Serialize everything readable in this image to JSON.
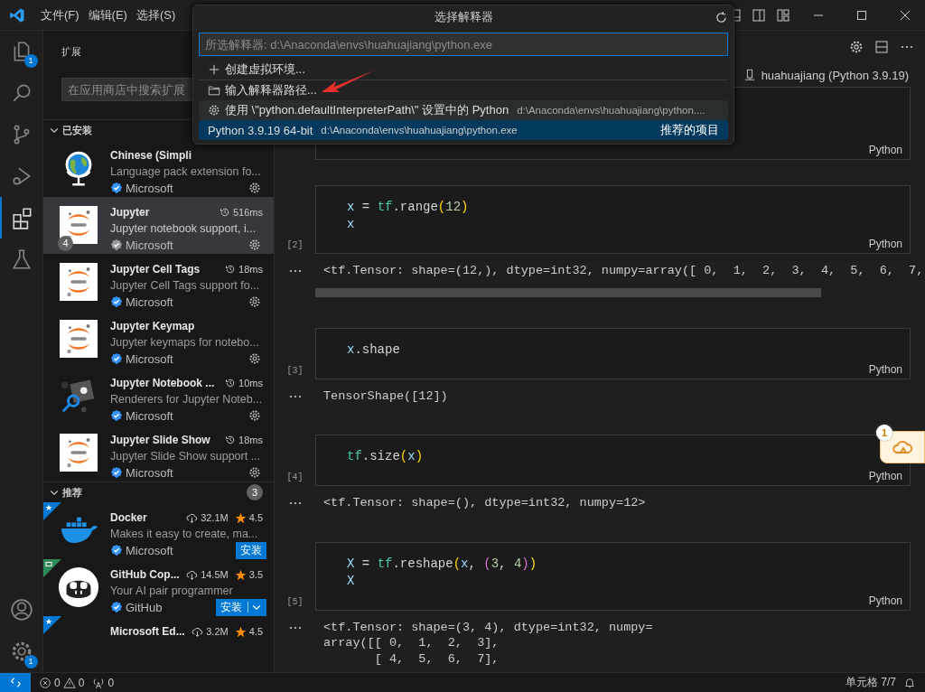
{
  "title_bar": {
    "menus": [
      "文件(F)",
      "编辑(E)",
      "选择(S)"
    ]
  },
  "activity_bar": {
    "items": [
      {
        "kind": "files",
        "selected": false,
        "badge": "1"
      },
      {
        "kind": "search",
        "selected": false
      },
      {
        "kind": "source-control",
        "selected": false
      },
      {
        "kind": "run",
        "selected": false
      },
      {
        "kind": "extensions",
        "selected": true
      },
      {
        "kind": "testing",
        "selected": false
      }
    ],
    "bottom": [
      {
        "kind": "account"
      },
      {
        "kind": "manage",
        "badge": "1"
      }
    ]
  },
  "sidebar": {
    "title": "扩展",
    "search": {
      "placeholder": "在应用商店中搜索扩展"
    },
    "sections": [
      {
        "title": "已安装",
        "expanded": true,
        "items": [
          {
            "kind": "globe",
            "name": "Chinese (Simpli",
            "description": "Language pack extension fo...",
            "publisher": "Microsoft",
            "selected": false
          },
          {
            "kind": "jupyter",
            "name": "Jupyter",
            "time": "516ms",
            "description": "Jupyter notebook support, i...",
            "publisher": "Microsoft",
            "badge": "4",
            "selected": true
          },
          {
            "kind": "jupyter",
            "name": "Jupyter Cell Tags",
            "time": "18ms",
            "description": "Jupyter Cell Tags support fo...",
            "publisher": "Microsoft",
            "selected": false
          },
          {
            "kind": "jupyter",
            "name": "Jupyter Keymap",
            "description": "Jupyter keymaps for notebo...",
            "publisher": "Microsoft",
            "selected": false
          },
          {
            "kind": "renderers",
            "name": "Jupyter Notebook ...",
            "time": "10ms",
            "description": "Renderers for Jupyter Noteb...",
            "publisher": "Microsoft",
            "selected": false
          },
          {
            "kind": "jupyter",
            "name": "Jupyter Slide Show",
            "time": "18ms",
            "description": "Jupyter Slide Show support ...",
            "publisher": "Microsoft",
            "selected": false
          }
        ]
      },
      {
        "title": "推荐",
        "expanded": true,
        "count": "3",
        "items": [
          {
            "kind": "docker",
            "ribbon": {
              "kind": "star"
            },
            "name": "Docker",
            "downloads": "32.1M",
            "rating": "4.5",
            "description": "Makes it easy to create, ma...",
            "publisher": "Microsoft",
            "install": "安装",
            "split": false,
            "selected": false
          },
          {
            "kind": "copilot",
            "ribbon": {
              "kind": "preview"
            },
            "name": "GitHub Cop...",
            "downloads": "14.5M",
            "rating": "3.5",
            "description": "Your AI pair programmer",
            "publisher": "GitHub",
            "install": "安装",
            "split": true,
            "selected": false
          },
          {
            "kind": "hidden",
            "ribbon": {
              "kind": "star"
            },
            "name": "Microsoft Ed...",
            "downloads": "3.2M",
            "rating": "4.5",
            "selected": false
          }
        ]
      }
    ]
  },
  "editor": {
    "kernel": "huahuajiang (Python 3.9.19)",
    "cells": [
      {
        "language": "Python"
      },
      {
        "count": "[2]",
        "language": "Python",
        "code": [
          [
            {
              "kind": "var",
              "t": "x"
            },
            {
              "kind": "op",
              "t": " = "
            },
            {
              "kind": "mod",
              "t": "tf"
            },
            {
              "kind": "op",
              "t": ".range"
            },
            {
              "kind": "b1",
              "t": "("
            },
            {
              "kind": "num",
              "t": "12"
            },
            {
              "kind": "b1",
              "t": ")"
            }
          ],
          [
            {
              "kind": "var",
              "t": "x"
            }
          ]
        ],
        "output": [
          "<tf.Tensor: shape=(12,), dtype=int32, numpy=array([ 0,  1,  2,  3,  4,  5,  6,  7,"
        ],
        "scrollbar": true
      },
      {
        "count": "[3]",
        "language": "Python",
        "code": [
          [
            {
              "kind": "var",
              "t": "x"
            },
            {
              "kind": "op",
              "t": ".shape"
            }
          ]
        ],
        "output": [
          "TensorShape([12])"
        ],
        "scrollbar": false
      },
      {
        "count": "[4]",
        "language": "Python",
        "code": [
          [
            {
              "kind": "mod",
              "t": "tf"
            },
            {
              "kind": "op",
              "t": ".size"
            },
            {
              "kind": "b1",
              "t": "("
            },
            {
              "kind": "var",
              "t": "x"
            },
            {
              "kind": "b1",
              "t": ")"
            }
          ]
        ],
        "output": [
          "<tf.Tensor: shape=(), dtype=int32, numpy=12>"
        ],
        "scrollbar": false
      },
      {
        "count": "[5]",
        "language": "Python",
        "code": [
          [
            {
              "kind": "var",
              "t": "X"
            },
            {
              "kind": "op",
              "t": " = "
            },
            {
              "kind": "mod",
              "t": "tf"
            },
            {
              "kind": "op",
              "t": ".reshape"
            },
            {
              "kind": "b1",
              "t": "("
            },
            {
              "kind": "var",
              "t": "x"
            },
            {
              "kind": "op",
              "t": ", "
            },
            {
              "kind": "b2",
              "t": "("
            },
            {
              "kind": "num",
              "t": "3"
            },
            {
              "kind": "op",
              "t": ", "
            },
            {
              "kind": "num",
              "t": "4"
            },
            {
              "kind": "b2",
              "t": ")"
            },
            {
              "kind": "b1",
              "t": ")"
            }
          ],
          [
            {
              "kind": "var",
              "t": "X"
            }
          ]
        ],
        "output": [
          "<tf.Tensor: shape=(3, 4), dtype=int32, numpy=",
          "array([[ 0,  1,  2,  3],",
          "       [ 4,  5,  6,  7],"
        ],
        "scrollbar": false
      }
    ]
  },
  "quick_pick": {
    "title": "选择解释器",
    "input": {
      "placeholder": "所选解释器: d:\\Anaconda\\envs\\huahuajiang\\python.exe"
    },
    "items": [
      {
        "kind": "add",
        "label": "创建虚拟环境...",
        "selected": false,
        "hover": false
      },
      {
        "kind": "folder",
        "label": "输入解释器路径...",
        "selected": false,
        "hover": false
      },
      {
        "kind": "gear",
        "label": "使用 \\\"python.defaultInterpreterPath\\\" 设置中的 Python",
        "detail": "d:\\Anaconda\\envs\\huahuajiang\\python....",
        "selected": false,
        "hover": true
      },
      {
        "kind": "interpreter",
        "label": "Python 3.9.19 64-bit",
        "detail": "d:\\Anaconda\\envs\\huahuajiang\\python.exe",
        "tag": "推荐的项目",
        "selected": true,
        "hover": false
      }
    ]
  },
  "floating_widget": {
    "badge": "1"
  },
  "status_bar": {
    "errors": "0",
    "warnings": "0",
    "ports": "0",
    "cell_position": "单元格 7/7"
  }
}
